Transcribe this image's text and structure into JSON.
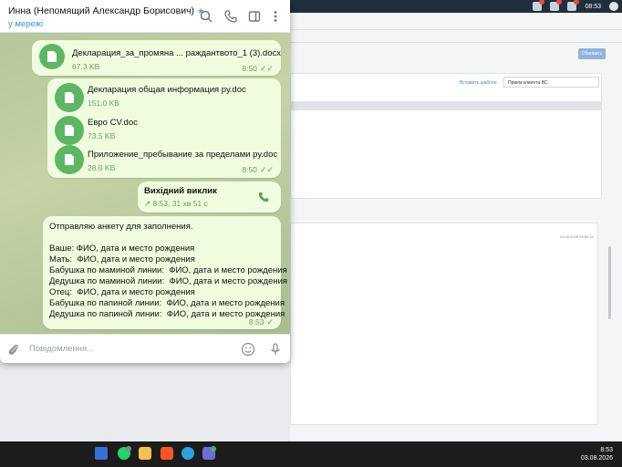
{
  "chat": {
    "contact_name": "Инна (Непомящий Александр Борисович)",
    "status": "у мережі",
    "messages": {
      "file1": {
        "name": "Декларация_за_промяна ... раждантвото_1 (3).docx",
        "size": "67.3 KB",
        "time": "8:50"
      },
      "file2": {
        "name": "Декларация общая информация ру.doc",
        "size": "151.0 KB"
      },
      "file3": {
        "name": "Евро CV.doc",
        "size": "73.5 KB"
      },
      "file4": {
        "name": "Приложение_пребывание за пределами ру.doc",
        "size": "28.0 KB",
        "time": "8:50"
      },
      "call": {
        "label": "Вихідний виклик",
        "details": "8:53, 31 хв 51 с"
      },
      "text": {
        "body": "Отправляю анкету для заполнения.\n\nВаше: ФИО, дата и место рождения\nМать:  ФИО, дата и место рождения\nБабушка по маминой линии:  ФИО, дата и место рождения\nДедушка по маминой линии:  ФИО, дата и место рождения\nОтец:  ФИО, дата и место рождения\nБабушка по папиной линии:  ФИО, дата и место рождения\nДедушка по папиной линии:  ФИО, дата и место рождения",
        "time": "8:53"
      }
    },
    "composer_placeholder": "Повідомлення..."
  },
  "background_app": {
    "update_button": "Обновить",
    "insert_template_link": "Вставить шаблон",
    "select_value": "Прием клиента ВС",
    "record_date": "03.08.2026 08:50:16"
  },
  "system": {
    "top_time": "08:53",
    "taskbar_time": "8:53",
    "taskbar_date": "03.08.2026"
  },
  "colors": {
    "bubble": "#effdde",
    "file_icon": "#5db664",
    "accent_blue": "#3a8fe0",
    "taskbar": "#1c1c1c"
  },
  "icons": [
    "search-icon",
    "phone-icon",
    "sidebar-toggle-icon",
    "more-vertical-icon",
    "file-icon",
    "outgoing-call-arrow-icon",
    "call-icon",
    "attach-icon",
    "emoji-icon",
    "microphone-icon",
    "read-checks-icon"
  ]
}
